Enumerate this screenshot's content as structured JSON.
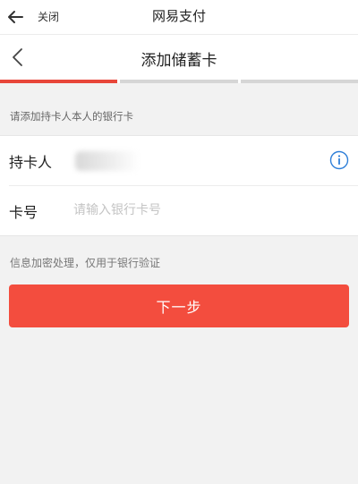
{
  "topbar": {
    "close_label": "关闭",
    "app_title": "网易支付"
  },
  "header": {
    "title": "添加储蓄卡"
  },
  "progress": {
    "steps_total": 3,
    "current_step": 1
  },
  "hint": "请添加持卡人本人的银行卡",
  "form": {
    "holder_label": "持卡人",
    "card_label": "卡号",
    "card_placeholder": "请输入银行卡号"
  },
  "note": "信息加密处理，仅用于银行验证",
  "next_button": "下一步",
  "colors": {
    "accent": "#f34d3e",
    "info": "#2f7fd8"
  }
}
